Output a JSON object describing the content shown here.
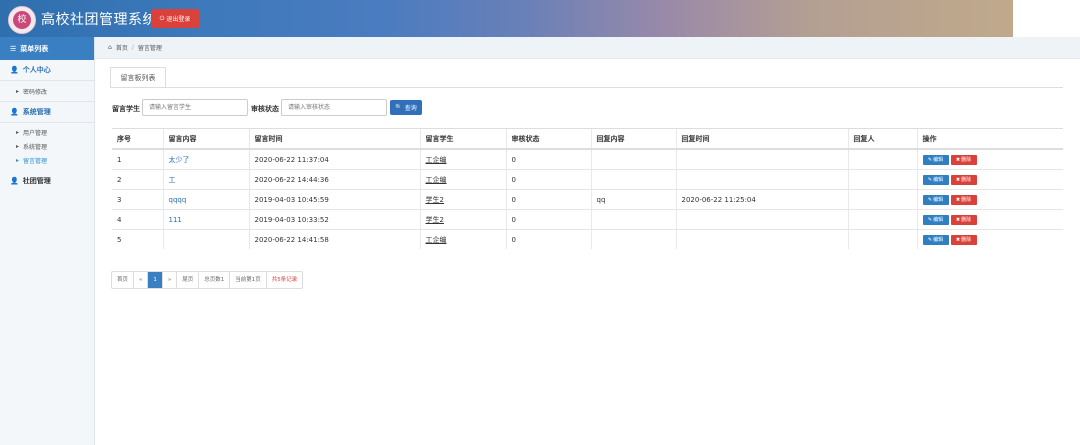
{
  "header": {
    "logo_glyph": "校",
    "title": "高校社团管理系统",
    "logout_label": "退出登录"
  },
  "sidebar": {
    "menu_title": "菜单列表",
    "groups": [
      {
        "label": "个人中心",
        "items": [
          {
            "label": "密码修改"
          }
        ]
      },
      {
        "label": "系统管理",
        "items": [
          {
            "label": "用户管理"
          },
          {
            "label": "系统管理"
          },
          {
            "label": "留言管理"
          }
        ]
      },
      {
        "label": "社团管理",
        "items": []
      }
    ]
  },
  "breadcrumb": {
    "home": "首页",
    "sep": "/",
    "current": "留言管理"
  },
  "tab": {
    "label": "留言板列表"
  },
  "search": {
    "student_label": "留言学生",
    "student_placeholder": "请输入留言学生",
    "status_label": "审核状态",
    "status_placeholder": "请输入审核状态",
    "button_label": "查询"
  },
  "table": {
    "headers": [
      "序号",
      "留言内容",
      "留言时间",
      "留言学生",
      "审核状态",
      "回复内容",
      "回复时间",
      "回复人",
      "操作"
    ],
    "rows": [
      {
        "no": "1",
        "content": "太少了",
        "time": "2020-06-22 11:37:04",
        "student": "工企编",
        "status": "0",
        "reply": "",
        "reply_time": "",
        "replier": ""
      },
      {
        "no": "2",
        "content": "工",
        "time": "2020-06-22 14:44:36",
        "student": "工企编",
        "status": "0",
        "reply": "",
        "reply_time": "",
        "replier": ""
      },
      {
        "no": "3",
        "content": "qqqq",
        "time": "2019-04-03 10:45:59",
        "student": "学生2",
        "status": "0",
        "reply": "qq",
        "reply_time": "2020-06-22 11:25:04",
        "replier": ""
      },
      {
        "no": "4",
        "content": "111",
        "time": "2019-04-03 10:33:52",
        "student": "学生2",
        "status": "0",
        "reply": "",
        "reply_time": "",
        "replier": ""
      },
      {
        "no": "5",
        "content": "",
        "time": "2020-06-22 14:41:58",
        "student": "工企编",
        "status": "0",
        "reply": "",
        "reply_time": "",
        "replier": ""
      }
    ],
    "edit_label": "编辑",
    "delete_label": "删除"
  },
  "pager": {
    "first": "首页",
    "prev": "«",
    "current": "1",
    "next": "»",
    "last": "尾页",
    "total_pages": "总页数1",
    "current_page": "当前第1页",
    "total_records": "共5条记录"
  },
  "colors": {
    "primary": "#3a7fc1",
    "danger": "#d9413a",
    "link": "#2a6fb4"
  }
}
